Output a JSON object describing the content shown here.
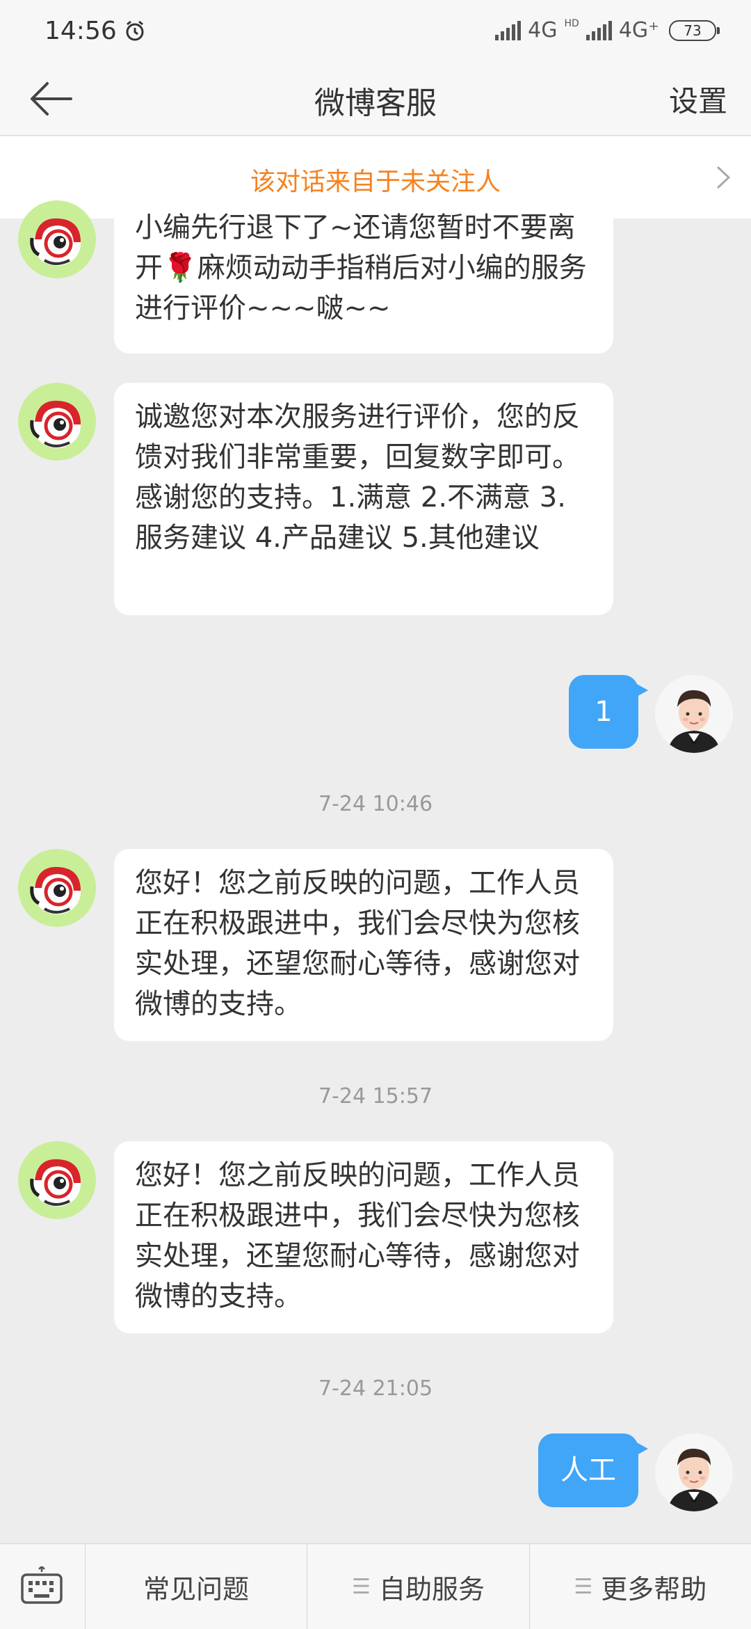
{
  "status": {
    "time": "14:56",
    "network1": "4G",
    "network2": "4G⁺",
    "hd": "HD",
    "battery": "73"
  },
  "nav": {
    "title": "微博客服",
    "settings": "设置"
  },
  "notice": {
    "text": "该对话来自于未关注人"
  },
  "messages": [
    {
      "from": "bot",
      "text": "小编先行退下了~还请您暂时不要离开🌹麻烦动动手指稍后对小编的服务进行评价~~~啵~~"
    },
    {
      "from": "bot",
      "text": "诚邀您对本次服务进行评价，您的反馈对我们非常重要，回复数字即可。感谢您的支持。1.满意 2.不满意 3.服务建议 4.产品建议 5.其他建议"
    },
    {
      "from": "user",
      "text": "1"
    },
    {
      "timestamp": "7-24 10:46"
    },
    {
      "from": "bot",
      "text": "您好！您之前反映的问题，工作人员正在积极跟进中，我们会尽快为您核实处理，还望您耐心等待，感谢您对微博的支持。"
    },
    {
      "timestamp": "7-24 15:57"
    },
    {
      "from": "bot",
      "text": "您好！您之前反映的问题，工作人员正在积极跟进中，我们会尽快为您核实处理，还望您耐心等待，感谢您对微博的支持。"
    },
    {
      "timestamp": "7-24 21:05"
    },
    {
      "from": "user",
      "text": "人工"
    }
  ],
  "bottom": {
    "tab1": "常见问题",
    "tab2": "自助服务",
    "tab3": "更多帮助"
  }
}
